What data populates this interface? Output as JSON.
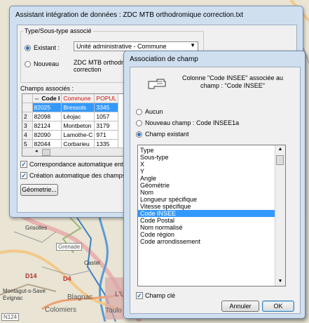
{
  "map": {
    "labels": [
      "Grisolles",
      "Grenade",
      "Castel",
      "Montagut-s-Save",
      "Blagnac",
      "Colomiers",
      "Toulo",
      "Evignac",
      "L'U",
      "D14",
      "D4",
      "N124"
    ]
  },
  "main_window": {
    "title": "Assistant intégration de données : ZDC MTB orthodromique correction.txt",
    "type_group": {
      "label": "Type/Sous-type associé",
      "existing_label": "Existant :",
      "existing_value": "Unité administrative - Commune",
      "new_label": "Nouveau",
      "new_value_line1": "ZDC MTB orthodrom",
      "new_value_line2": "correction"
    },
    "fields_label": "Champs associés :",
    "grid": {
      "columns": [
        "",
        "Code I",
        "Commune",
        "POPUL"
      ],
      "rows": [
        {
          "num": "",
          "code": "82025",
          "commune": "Bressols",
          "popul": "3345"
        },
        {
          "num": "2",
          "code": "82098",
          "commune": "Léojac",
          "popul": "1057"
        },
        {
          "num": "3",
          "code": "82124",
          "commune": "Montbeton",
          "popul": "3179"
        },
        {
          "num": "4",
          "code": "82090",
          "commune": "Lamothe-C",
          "popul": "971"
        },
        {
          "num": "5",
          "code": "82044",
          "commune": "Corbarieu",
          "popul": "1335"
        }
      ]
    },
    "auto_match_label": "Correspondance automatique entr",
    "auto_create_label": "Création automatique des champs",
    "geometry_button": "Géometrie..."
  },
  "assoc_dialog": {
    "title": "Association de champ",
    "info_line1": "Colonne \"Code INSEE\" associée au",
    "info_line2": "champ : \"Code INSEE\"",
    "options": {
      "none": "Aucun",
      "new_field": "Nouveau champ : Code INSEE1a",
      "existing_field": "Champ existant"
    },
    "fields": [
      "Type",
      "Sous-type",
      "X",
      "Y",
      "Angle",
      "Géométrie",
      "Nom",
      "Longueur spécifique",
      "Vitesse spécifique",
      "Code INSEE",
      "Code Postal",
      "Nom normalisé",
      "Code région",
      "Code arrondissement"
    ],
    "selected_field": "Code INSEE",
    "key_field_label": "Champ clé",
    "cancel_button": "Annuler",
    "ok_button": "OK"
  },
  "colors": {
    "selection": "#3399ff",
    "window_frame": "#cfdff0",
    "header_red": "#cc1111"
  }
}
